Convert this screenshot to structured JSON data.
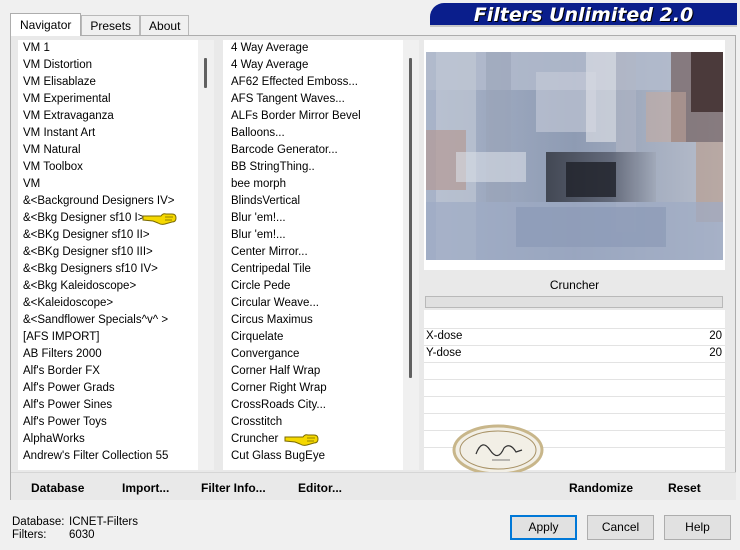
{
  "title": "Filters Unlimited 2.0",
  "tabs": [
    {
      "label": "Navigator",
      "active": true
    },
    {
      "label": "Presets",
      "active": false
    },
    {
      "label": "About",
      "active": false
    }
  ],
  "categories": [
    "VM 1",
    "VM Distortion",
    "VM Elisablaze",
    "VM Experimental",
    "VM Extravaganza",
    "VM Instant Art",
    "VM Natural",
    "VM Toolbox",
    "VM",
    "&<Background Designers IV>",
    "&<Bkg Designer sf10 I>",
    "&<BKg Designer sf10 II>",
    "&<BKg Designer sf10 III>",
    "&<Bkg Designers sf10 IV>",
    "&<Bkg Kaleidoscope>",
    "&<Kaleidoscope>",
    "&<Sandflower Specials^v^ >",
    "[AFS IMPORT]",
    "AB Filters 2000",
    "Alf's Border FX",
    "Alf's Power Grads",
    "Alf's Power Sines",
    "Alf's Power Toys",
    "AlphaWorks",
    "Andrew's Filter Collection 55"
  ],
  "filters": [
    "4 Way Average",
    "4 Way Average",
    "AF62 Effected Emboss...",
    "AFS Tangent Waves...",
    "ALFs Border Mirror Bevel",
    "Balloons...",
    "Barcode Generator...",
    "BB StringThing..",
    "bee morph",
    "BlindsVertical",
    "Blur 'em!...",
    "Blur 'em!...",
    "Center Mirror...",
    "Centripedal Tile",
    "Circle Pede",
    "Circular Weave...",
    "Circus Maximus",
    "Cirquelate",
    "Convergance",
    "Corner Half Wrap",
    "Corner Right Wrap",
    "CrossRoads City...",
    "Crosstitch",
    "Cruncher",
    "Cut Glass  BugEye"
  ],
  "selected_filter": "Cruncher",
  "params": [
    {
      "label": "X-dose",
      "value": "20"
    },
    {
      "label": "Y-dose",
      "value": "20"
    }
  ],
  "buttons": {
    "database": "Database",
    "import": "Import...",
    "filter_info": "Filter Info...",
    "editor": "Editor...",
    "randomize": "Randomize",
    "reset": "Reset",
    "apply": "Apply",
    "cancel": "Cancel",
    "help": "Help"
  },
  "status": {
    "database_label": "Database:",
    "database_value": "ICNET-Filters",
    "filters_label": "Filters:",
    "filters_value": "6030"
  },
  "colors": {
    "banner": "#0a1e8c",
    "default_button_border": "#0078d7",
    "pointer_hand": "#f5d800"
  }
}
